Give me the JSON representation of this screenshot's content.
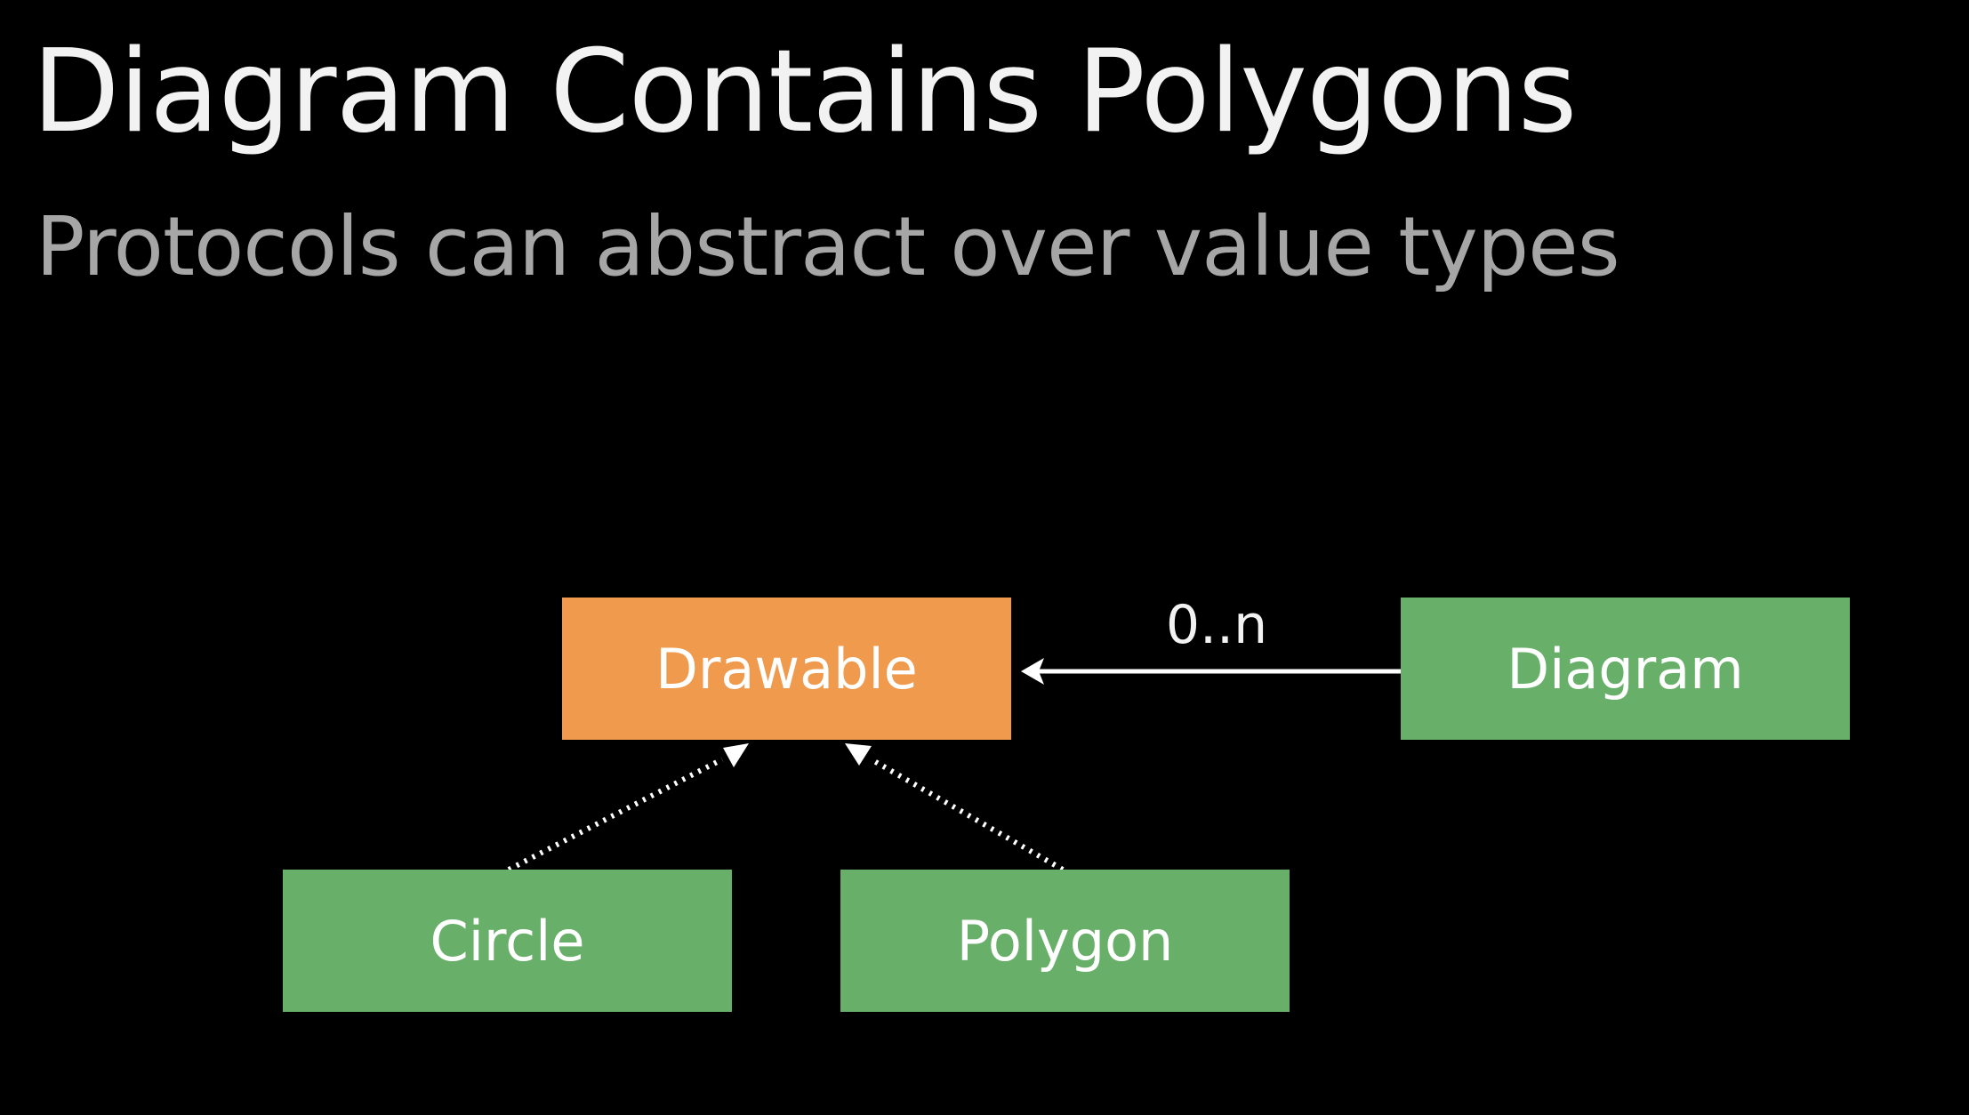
{
  "slide": {
    "title": "Diagram Contains Polygons",
    "subtitle": "Protocols can abstract over value types"
  },
  "diagram": {
    "nodes": {
      "drawable": "Drawable",
      "diagram": "Diagram",
      "circle": "Circle",
      "polygon": "Polygon"
    },
    "edges": {
      "diagram_to_drawable": {
        "from": "Diagram",
        "to": "Drawable",
        "kind": "association",
        "multiplicity": "0..n"
      },
      "circle_to_drawable": {
        "from": "Circle",
        "to": "Drawable",
        "kind": "conformance (dotted)"
      },
      "polygon_to_drawable": {
        "from": "Polygon",
        "to": "Drawable",
        "kind": "conformance (dotted)"
      }
    }
  },
  "colors": {
    "background": "#000000",
    "title": "#f2f2f2",
    "subtitle": "#a6a6a6",
    "protocol_box": "#ef9a4d",
    "value_type_box": "#68b06a",
    "connector": "#ffffff"
  }
}
